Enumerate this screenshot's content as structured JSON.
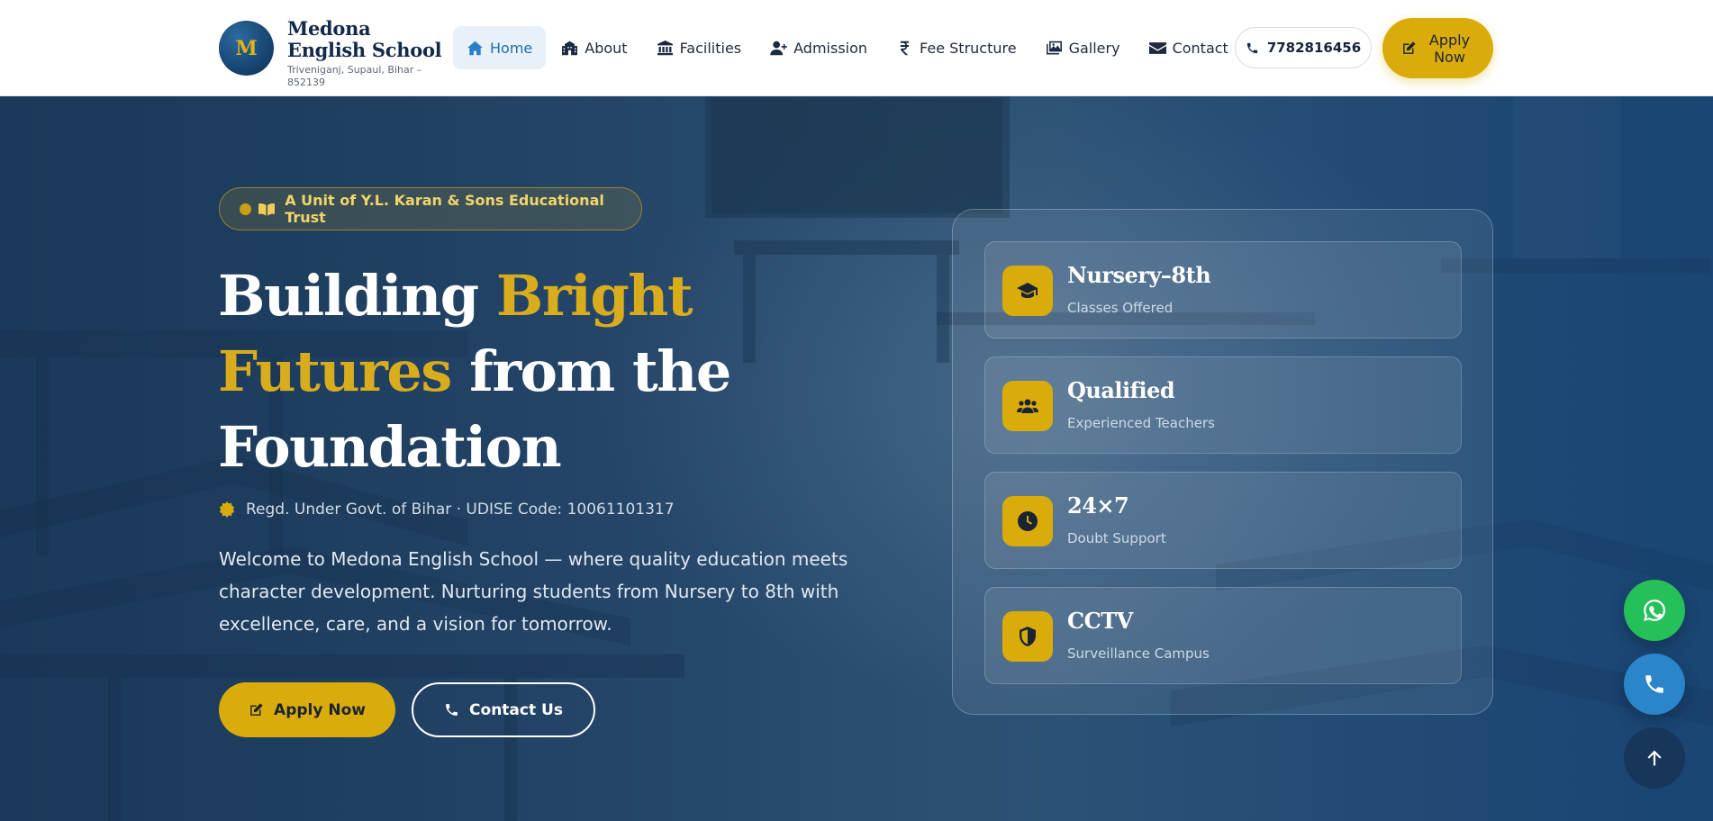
{
  "brand": {
    "logo_letter": "M",
    "name": "Medona English School",
    "address": "Triveniganj, Supaul, Bihar – 852139"
  },
  "nav": {
    "items": [
      {
        "label": "Home",
        "icon": "home-icon",
        "active": true
      },
      {
        "label": "About",
        "icon": "school-building-icon"
      },
      {
        "label": "Facilities",
        "icon": "landmark-icon"
      },
      {
        "label": "Admission",
        "icon": "user-plus-icon"
      },
      {
        "label": "Fee Structure",
        "icon": "rupee-icon"
      },
      {
        "label": "Gallery",
        "icon": "images-icon"
      },
      {
        "label": "Contact",
        "icon": "envelope-icon"
      }
    ],
    "phone": "7782816456",
    "apply_label": "Apply Now"
  },
  "hero": {
    "badge": "A Unit of Y.L. Karan & Sons Educational Trust",
    "title_part1": "Building ",
    "title_highlight": "Bright Futures",
    "title_part2": " from the Foundation",
    "registration": "Regd. Under Govt. of Bihar · UDISE Code: 10061101317",
    "description": "Welcome to Medona English School — where quality education meets character development. Nurturing students from Nursery to 8th with excellence, care, and a vision for tomorrow.",
    "apply_button": "Apply Now",
    "contact_button": "Contact Us"
  },
  "stats": [
    {
      "value": "Nursery–8th",
      "label": "Classes Offered",
      "icon": "graduation-cap-icon"
    },
    {
      "value": "Qualified",
      "label": "Experienced Teachers",
      "icon": "users-icon"
    },
    {
      "value": "24×7",
      "label": "Doubt Support",
      "icon": "clock-icon"
    },
    {
      "value": "CCTV",
      "label": "Surveillance Campus",
      "icon": "shield-icon"
    }
  ],
  "colors": {
    "accent": "#d9ac0b",
    "brand_navy": "#13294b",
    "nav_active": "#1f6fb2",
    "whatsapp": "#25c05a",
    "call": "#2a85c9"
  }
}
